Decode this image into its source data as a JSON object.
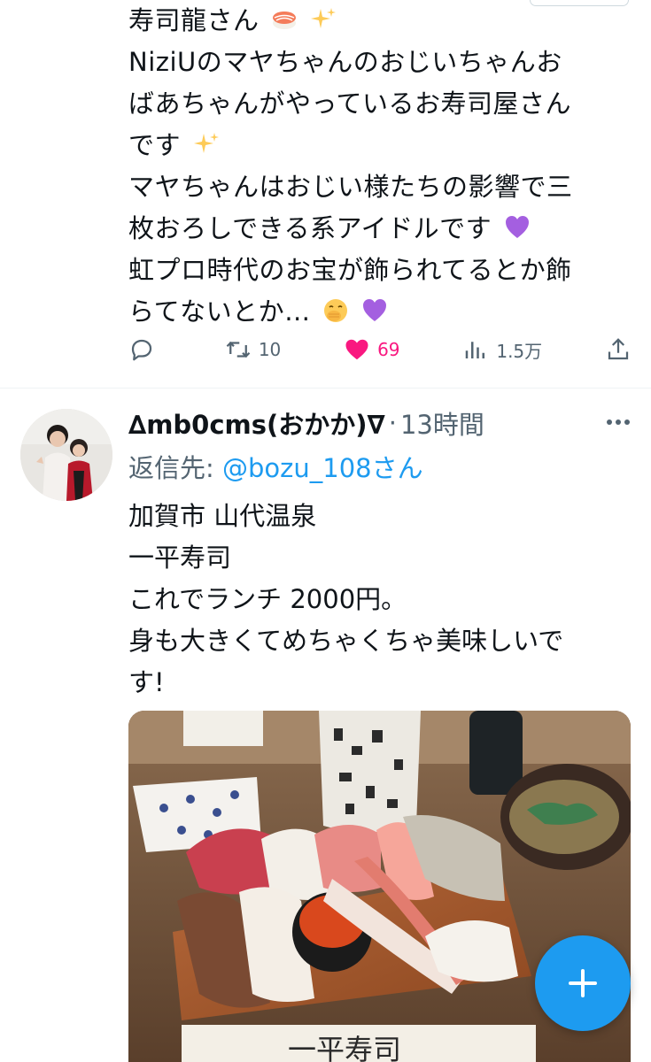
{
  "tweet1": {
    "lines": [
      "寿司龍さん",
      "NiziUのマヤちゃんのおじいちゃんお",
      "ばあちゃんがやっているお寿司屋さん",
      "です",
      "マヤちゃんはおじい様たちの影響で三",
      "枚おろしできる系アイドルです",
      "虹プロ時代のお宝が飾られてるとか飾",
      "らてないとか…"
    ],
    "emoji": [
      "sushi-emoji",
      "sparkles-emoji",
      "sparkles-emoji",
      "purple-heart-emoji",
      "face-with-hand-over-mouth-emoji",
      "purple-heart-emoji"
    ],
    "actions": {
      "reply_count": "",
      "retweet_count": "10",
      "like_count": "69",
      "views_count": "1.5万"
    },
    "like_color": "#f91880"
  },
  "tweet2": {
    "author_name": "∆mb0cms(おかか)∇",
    "separator": "·",
    "time": "13時間",
    "reply_prefix": "返信先: ",
    "reply_handle": "@bozu_108さん",
    "lines": [
      "加賀市 山代温泉",
      "一平寿司",
      "これでランチ 2000円。",
      "身も大きくてめちゃくちゃ美味しいで",
      "す!"
    ],
    "photo_sign_text": "一平寿司"
  },
  "colors": {
    "accent": "#1d9bf0",
    "secondary_text": "#536471",
    "divider": "#eff3f4"
  },
  "icons": {
    "reply": "reply-icon",
    "retweet": "retweet-icon",
    "like": "heart-icon",
    "views": "analytics-icon",
    "share": "share-icon",
    "more": "more-icon",
    "compose": "plus-icon"
  }
}
